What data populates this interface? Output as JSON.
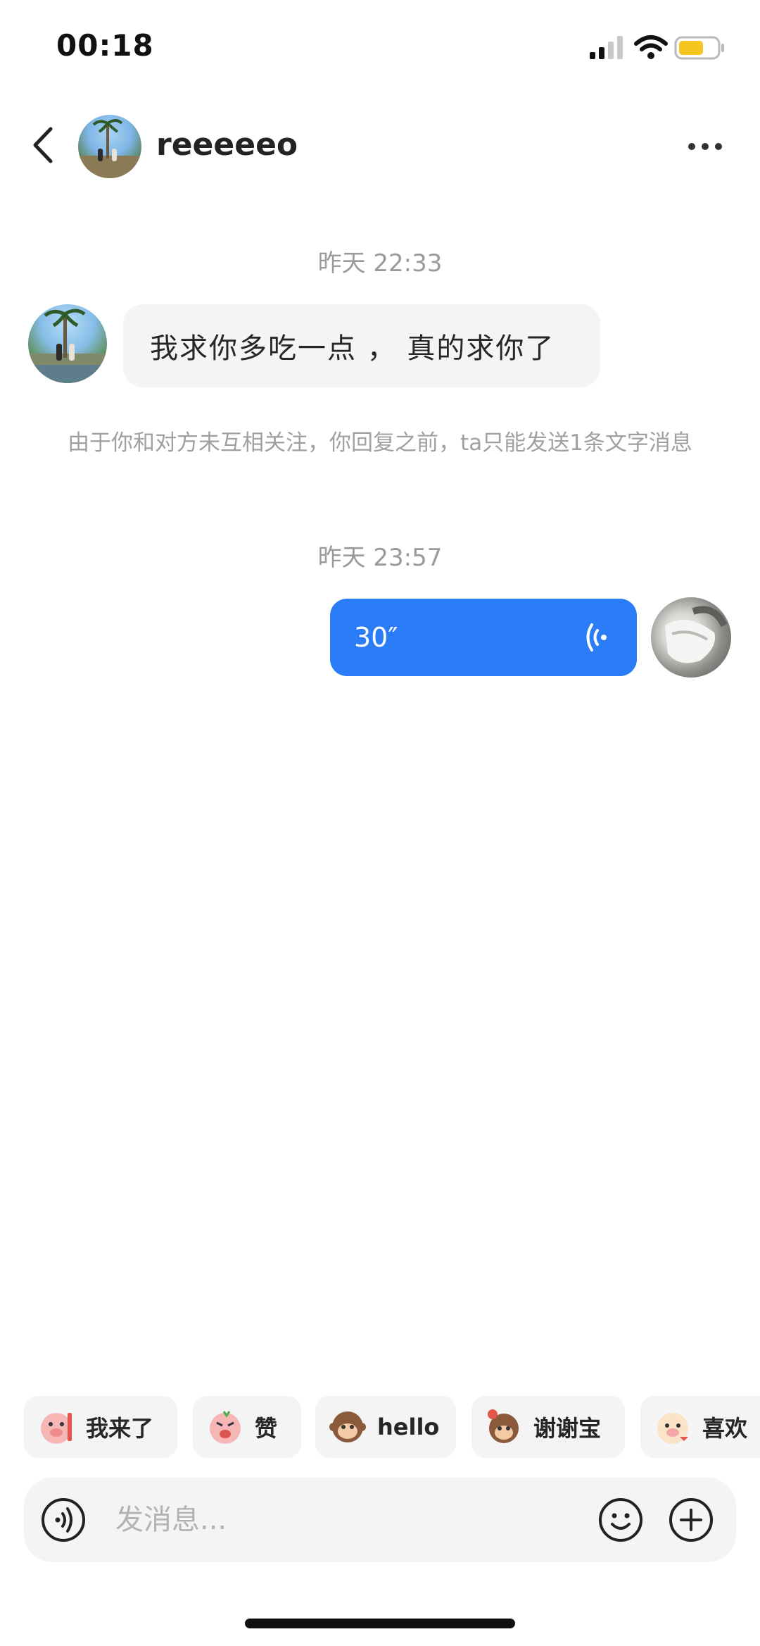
{
  "status_bar": {
    "time": "00:18",
    "icons": [
      "signal-icon",
      "wifi-icon",
      "battery-icon"
    ],
    "battery_color": "#f7c520"
  },
  "header": {
    "back_icon": "chevron-left-icon",
    "contact_name": "reeeeeo",
    "more_icon": "more-dots-icon"
  },
  "messages": [
    {
      "type": "timestamp",
      "text": "昨天 22:33"
    },
    {
      "type": "text",
      "from": "peer",
      "text": "我求你多吃一点 ， 真的求你了"
    },
    {
      "type": "system_notice",
      "text": "由于你和对方未互相关注，你回复之前，ta只能发送1条文字消息"
    },
    {
      "type": "timestamp",
      "text": "昨天 23:57"
    },
    {
      "type": "voice",
      "from": "me",
      "duration": "30″",
      "icon": "voice-wave-icon"
    }
  ],
  "quick_replies": [
    {
      "label": "我来了",
      "icon": "pig-sticker-icon"
    },
    {
      "label": "赞",
      "icon": "pig-sticker-icon"
    },
    {
      "label": "hello",
      "icon": "monkey-sticker-icon"
    },
    {
      "label": "谢谢宝",
      "icon": "monkey-sticker-icon"
    },
    {
      "label": "喜欢",
      "icon": "pig-sticker-icon"
    }
  ],
  "input_bar": {
    "placeholder": "发消息...",
    "value": "",
    "voice_icon": "voice-input-icon",
    "emoji_icon": "smiley-icon",
    "plus_icon": "plus-circle-icon"
  },
  "colors": {
    "accent": "#2b7cf7",
    "bubble_gray": "#f4f4f5",
    "meta_text": "#9a9a9a"
  }
}
